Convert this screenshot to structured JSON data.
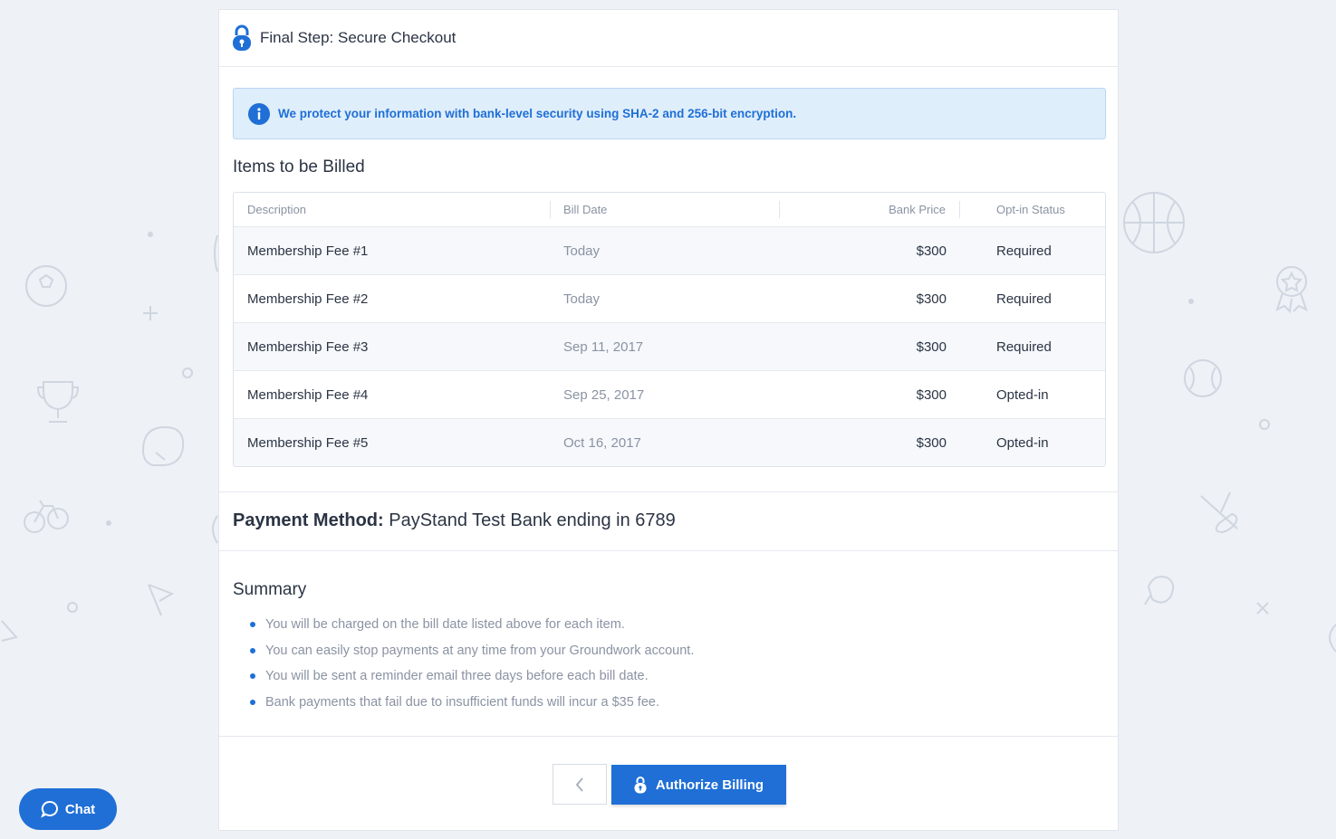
{
  "header": {
    "title": "Final Step: Secure Checkout",
    "icon": "lock-icon"
  },
  "notice": {
    "icon": "info-icon",
    "text": "We protect your information with bank-level security using SHA-2 and 256-bit encryption."
  },
  "items_section": {
    "title": "Items to be Billed"
  },
  "table": {
    "columns": [
      "Description",
      "Bill Date",
      "Bank Price",
      "Opt-in Status"
    ],
    "rows": [
      {
        "description": "Membership Fee #1",
        "bill_date": "Today",
        "price": "$300",
        "status": "Required"
      },
      {
        "description": "Membership Fee #2",
        "bill_date": "Today",
        "price": "$300",
        "status": "Required"
      },
      {
        "description": "Membership Fee #3",
        "bill_date": "Sep 11, 2017",
        "price": "$300",
        "status": "Required"
      },
      {
        "description": "Membership Fee #4",
        "bill_date": "Sep 25, 2017",
        "price": "$300",
        "status": "Opted-in"
      },
      {
        "description": "Membership Fee #5",
        "bill_date": "Oct 16, 2017",
        "price": "$300",
        "status": "Opted-in"
      }
    ]
  },
  "payment": {
    "label": "Payment Method:",
    "value": "PayStand Test Bank ending in 6789"
  },
  "summary": {
    "title": "Summary",
    "items": [
      "You will be charged on the bill date listed above for each item.",
      "You can easily stop payments at any time from your Groundwork account.",
      "You will be sent a reminder email three days before each bill date.",
      "Bank payments that fail due to insufficient funds will incur a $35 fee."
    ]
  },
  "actions": {
    "back_icon": "chevron-left-icon",
    "authorize_label": "Authorize Billing"
  },
  "chat": {
    "label": "Chat",
    "icon": "chat-bubble-icon"
  },
  "colors": {
    "accent": "#1f6fd6",
    "notice_bg": "#dfeefb",
    "page_bg": "#eef1f6",
    "muted_text": "#8a93a3"
  }
}
